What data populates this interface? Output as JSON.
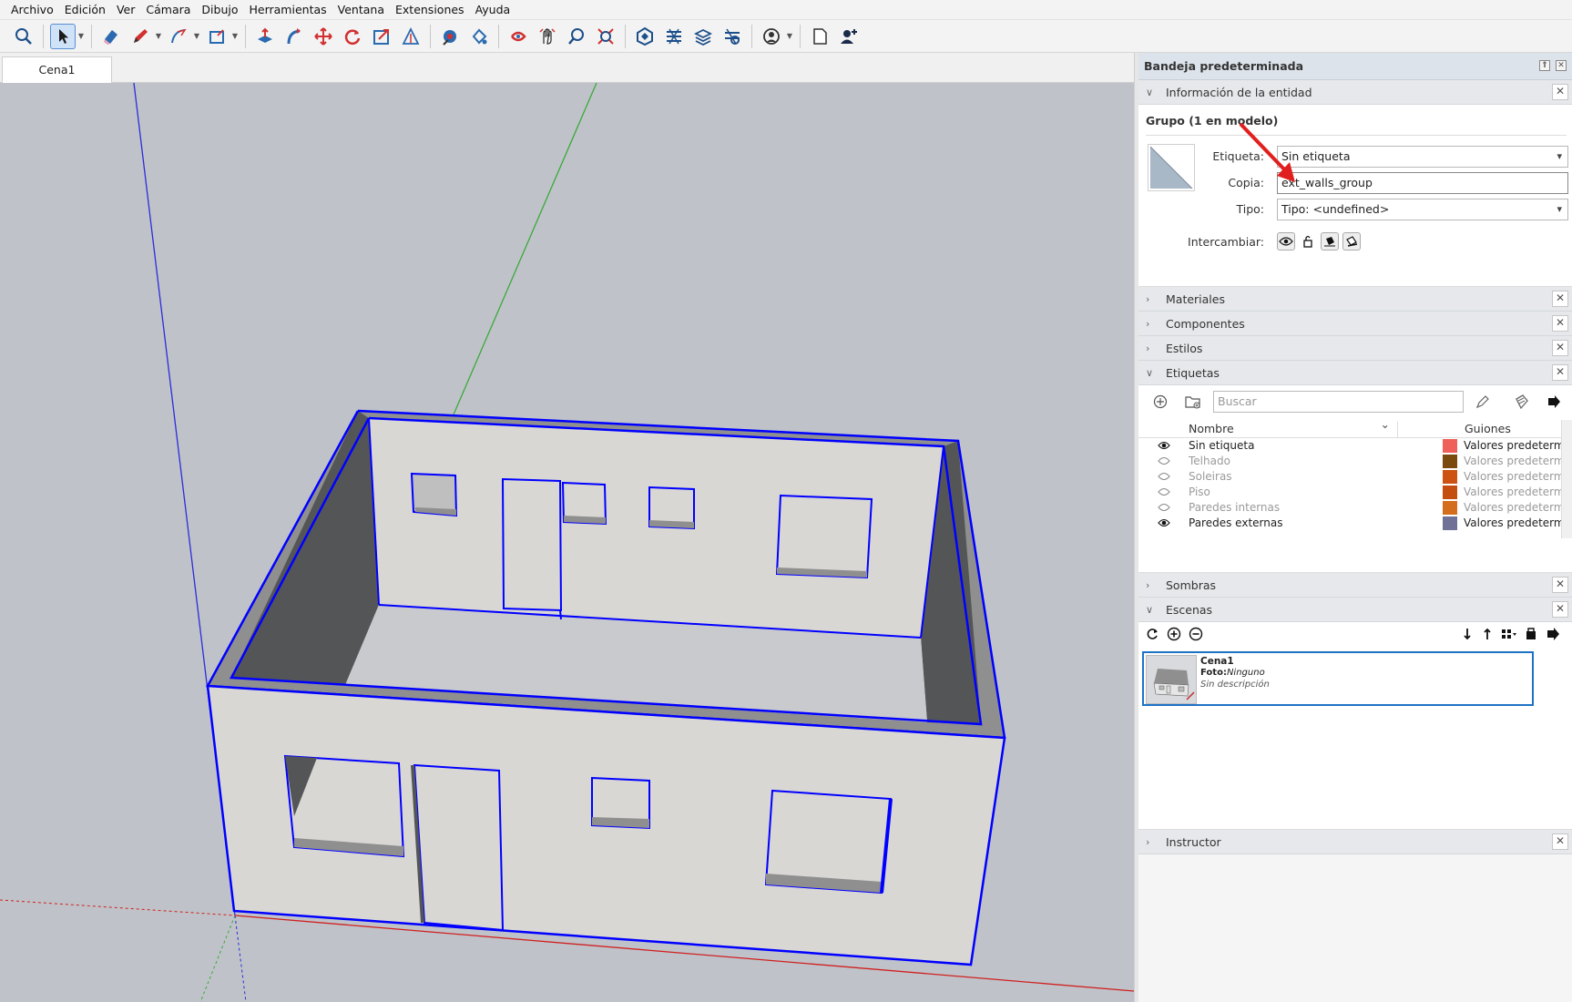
{
  "menus": [
    "Archivo",
    "Edición",
    "Ver",
    "Cámara",
    "Dibujo",
    "Herramientas",
    "Ventana",
    "Extensiones",
    "Ayuda"
  ],
  "scene_tab": "Cena1",
  "tray": {
    "title": "Bandeja predeterminada",
    "entity_info": {
      "header": "Información de la entidad",
      "title": "Grupo (1 en modelo)",
      "label_tag": "Etiqueta:",
      "value_tag": "Sin etiqueta",
      "label_instance": "Copia:",
      "value_instance": "ext_walls_group",
      "label_type": "Tipo:",
      "value_type": "Tipo: <undefined>",
      "label_toggle": "Intercambiar:"
    },
    "panels": {
      "materials": "Materiales",
      "components": "Componentes",
      "styles": "Estilos",
      "tags": "Etiquetas",
      "shadows": "Sombras",
      "scenes": "Escenas",
      "instructor": "Instructor"
    },
    "tags": {
      "search_placeholder": "Buscar",
      "col_name": "Nombre",
      "col_dashes": "Guiones",
      "rows": [
        {
          "name": "Sin etiqueta",
          "visible": true,
          "color": "#f0605a",
          "dashes": "Valores predeterminados"
        },
        {
          "name": "Telhado",
          "visible": false,
          "color": "#7a4a0f",
          "dashes": "Valores predeterminados"
        },
        {
          "name": "Soleiras",
          "visible": false,
          "color": "#cc5312",
          "dashes": "Valores predeterminados"
        },
        {
          "name": "Piso",
          "visible": false,
          "color": "#c44d10",
          "dashes": "Valores predeterminados"
        },
        {
          "name": "Paredes internas",
          "visible": false,
          "color": "#d46d1c",
          "dashes": "Valores predeterminados"
        },
        {
          "name": "Paredes externas",
          "visible": true,
          "color": "#6f7296",
          "dashes": "Valores predeterminados"
        }
      ]
    },
    "scenes": {
      "name": "Cena1",
      "foto_label": "Foto:",
      "foto_value": "Ninguno",
      "description": "Sin descripción"
    }
  },
  "colors": {
    "selection": "#0000ff",
    "viewport": "#bfc3c9",
    "wall_face": "#d9d7d4",
    "wall_top": "#8f8f8f",
    "wall_inner_dark": "#545557",
    "accent_arrow": "#e0201f"
  }
}
